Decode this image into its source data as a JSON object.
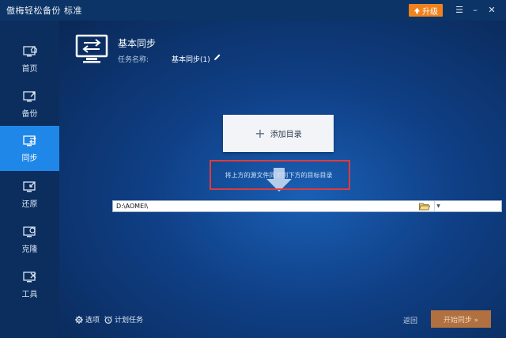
{
  "app": {
    "title": "傲梅轻松备份 标准"
  },
  "titlebar": {
    "upgrade_label": "升级",
    "menu_glyph": "☰",
    "minimize_glyph": "–",
    "close_glyph": "✕"
  },
  "sidebar": {
    "items": [
      {
        "label": "首页",
        "icon": "home-icon"
      },
      {
        "label": "备份",
        "icon": "backup-icon"
      },
      {
        "label": "同步",
        "icon": "sync-icon",
        "active": true
      },
      {
        "label": "还原",
        "icon": "restore-icon"
      },
      {
        "label": "克隆",
        "icon": "clone-icon"
      },
      {
        "label": "工具",
        "icon": "tools-icon"
      }
    ]
  },
  "header": {
    "title": "基本同步",
    "task_label": "任务名称:",
    "task_name": "基本同步(1)"
  },
  "main": {
    "add_directory_label": "添加目录",
    "hint": "将上方的源文件同步到下方的目标目录",
    "target_path": "D:\\AOMEI\\"
  },
  "footer": {
    "options_label": "选项",
    "schedule_label": "计划任务",
    "back_label": "返回",
    "start_label": "开始同步 »"
  },
  "colors": {
    "accent": "#1f87e8",
    "upgrade": "#f0821e",
    "start": "#b0703f",
    "highlight": "#e23a3a"
  }
}
